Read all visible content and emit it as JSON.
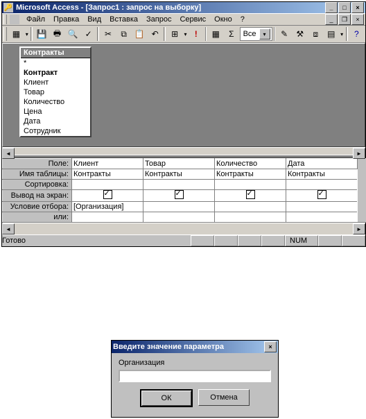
{
  "main_window": {
    "title": "Microsoft Access - [Запрос1 : запрос на выборку]",
    "menu": [
      "Файл",
      "Правка",
      "Вид",
      "Вставка",
      "Запрос",
      "Сервис",
      "Окно",
      "?"
    ],
    "toolbar": {
      "combo_value": "Все",
      "icons": [
        "view-icon",
        "save-icon",
        "print-icon",
        "preview-icon",
        "spell-icon",
        "cut-icon",
        "copy-icon",
        "paste-icon",
        "undo-icon",
        "query-type-icon",
        "run-icon",
        "show-table-icon",
        "totals-icon",
        "top-values-combo",
        "props-icon",
        "build-icon",
        "db-window-icon",
        "new-object-icon",
        "help-icon"
      ]
    },
    "fieldlist": {
      "title": "Контракты",
      "items": [
        "*",
        "Контракт",
        "Клиент",
        "Товар",
        "Количество",
        "Цена",
        "Дата",
        "Сотрудник"
      ],
      "bold_index": 1
    },
    "grid": {
      "row_labels": [
        "Поле:",
        "Имя таблицы:",
        "Сортировка:",
        "Вывод на экран:",
        "Условие отбора:",
        "или:"
      ],
      "columns": [
        {
          "field": "Клиент",
          "table": "Контракты",
          "sort": "",
          "show": true,
          "criteria": "[Организация]",
          "or": ""
        },
        {
          "field": "Товар",
          "table": "Контракты",
          "sort": "",
          "show": true,
          "criteria": "",
          "or": ""
        },
        {
          "field": "Количество",
          "table": "Контракты",
          "sort": "",
          "show": true,
          "criteria": "",
          "or": ""
        },
        {
          "field": "Дата",
          "table": "Контракты",
          "sort": "",
          "show": true,
          "criteria": "",
          "or": ""
        }
      ]
    },
    "statusbar": {
      "text": "Готово",
      "indicator": "NUM"
    }
  },
  "dialog": {
    "title": "Введите значение параметра",
    "label": "Организация",
    "value": "",
    "ok": "ОК",
    "cancel": "Отмена"
  }
}
